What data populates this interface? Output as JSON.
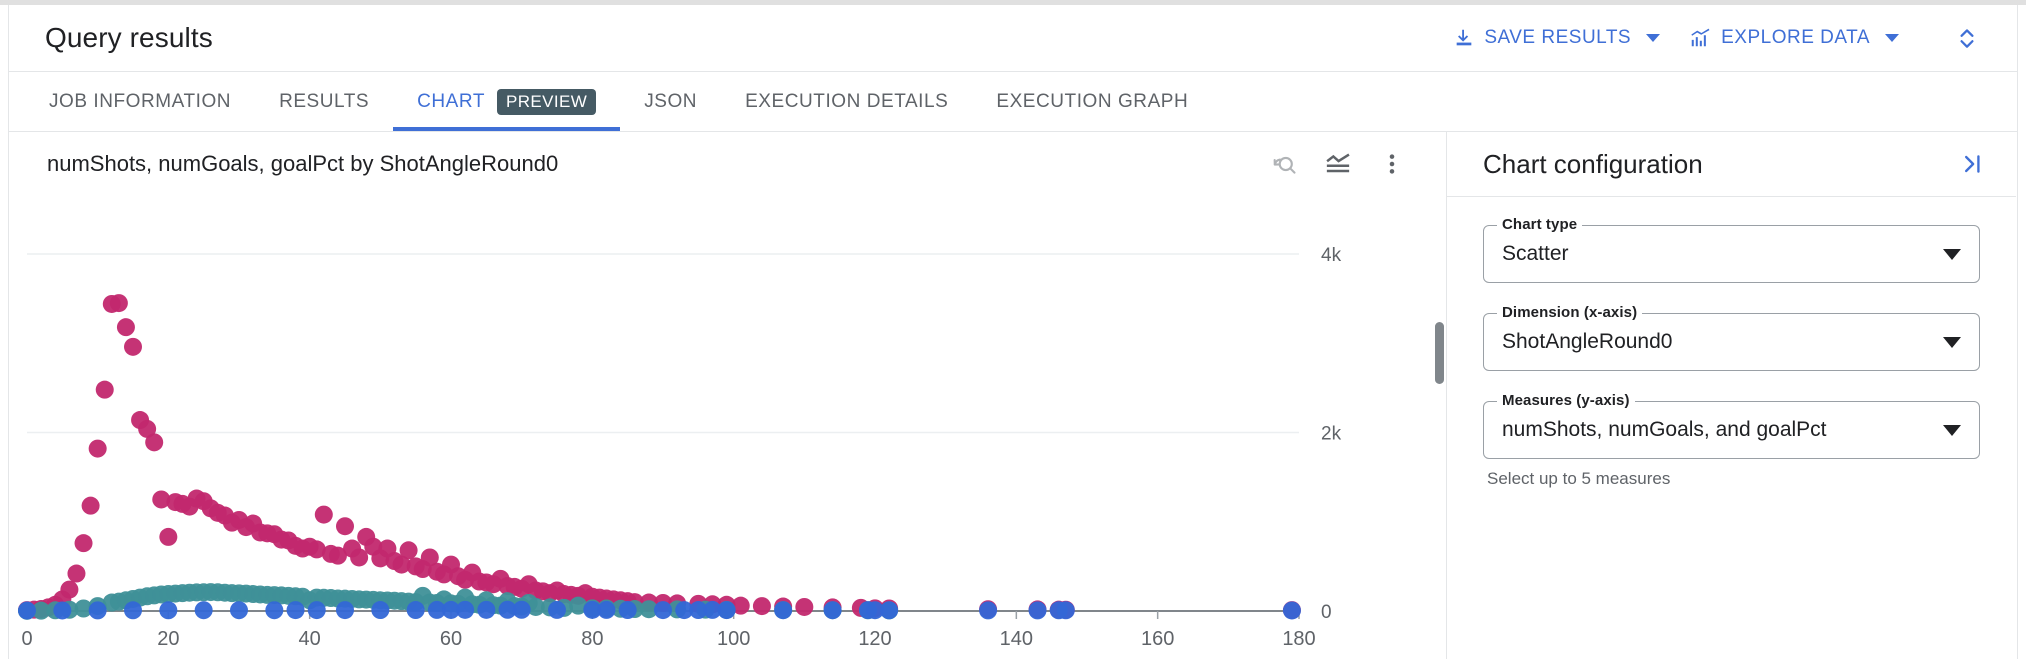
{
  "header": {
    "title": "Query results",
    "save_results_label": "SAVE RESULTS",
    "explore_data_label": "EXPLORE DATA",
    "save_icon": "download-icon",
    "explore_icon": "bar-chart-trend-icon",
    "expand_icon": "unfold-more-icon"
  },
  "tabs": [
    {
      "label": "JOB INFORMATION",
      "active": false
    },
    {
      "label": "RESULTS",
      "active": false
    },
    {
      "label": "CHART",
      "active": true,
      "chip": "PREVIEW"
    },
    {
      "label": "JSON",
      "active": false
    },
    {
      "label": "EXECUTION DETAILS",
      "active": false
    },
    {
      "label": "EXECUTION GRAPH",
      "active": false
    }
  ],
  "chart_panel": {
    "title": "numShots, numGoals, goalPct by ShotAngleRound0",
    "tools": [
      {
        "name": "reset-zoom-icon"
      },
      {
        "name": "chart-series-toggle-icon"
      },
      {
        "name": "more-options-icon"
      }
    ]
  },
  "config": {
    "title": "Chart configuration",
    "collapse_icon": "collapse-panel-right-icon",
    "fields": [
      {
        "label": "Chart type",
        "value": "Scatter"
      },
      {
        "label": "Dimension (x-axis)",
        "value": "ShotAngleRound0"
      },
      {
        "label": "Measures (y-axis)",
        "value": "numShots, numGoals, and goalPct",
        "hint": "Select up to 5 measures"
      }
    ]
  },
  "colors": {
    "accent_blue": "#3f6fd6",
    "series_numshots": "#c2286e",
    "series_numgoals": "#3f9098",
    "series_goalpct": "#3367d6",
    "preview_chip": "#455a64",
    "text_primary": "#202124",
    "text_secondary": "#5f6368"
  },
  "chart_data": {
    "type": "scatter",
    "title": "numShots, numGoals, goalPct by ShotAngleRound0",
    "xlabel": "ShotAngleRound0",
    "ylabel": "",
    "xlim": [
      0,
      180
    ],
    "ylim": [
      0,
      4000
    ],
    "xticks": [
      0,
      20,
      40,
      60,
      80,
      100,
      120,
      140,
      160,
      180
    ],
    "yticks": [
      0,
      2000,
      4000
    ],
    "ytick_labels": [
      "0",
      "2k",
      "4k"
    ],
    "grid": "horizontal",
    "legend_position": "none",
    "series": [
      {
        "name": "numShots",
        "color": "#c2286e",
        "points": [
          [
            0,
            10
          ],
          [
            1,
            15
          ],
          [
            2,
            22
          ],
          [
            3,
            40
          ],
          [
            4,
            70
          ],
          [
            5,
            130
          ],
          [
            6,
            240
          ],
          [
            7,
            420
          ],
          [
            8,
            760
          ],
          [
            9,
            1180
          ],
          [
            10,
            1820
          ],
          [
            11,
            2480
          ],
          [
            12,
            3440
          ],
          [
            13,
            3450
          ],
          [
            14,
            3180
          ],
          [
            15,
            2960
          ],
          [
            16,
            2140
          ],
          [
            17,
            2040
          ],
          [
            18,
            1890
          ],
          [
            19,
            1250
          ],
          [
            20,
            830
          ],
          [
            21,
            1220
          ],
          [
            22,
            1200
          ],
          [
            23,
            1170
          ],
          [
            24,
            1260
          ],
          [
            25,
            1230
          ],
          [
            26,
            1150
          ],
          [
            27,
            1100
          ],
          [
            28,
            1070
          ],
          [
            29,
            990
          ],
          [
            30,
            1020
          ],
          [
            31,
            940
          ],
          [
            32,
            980
          ],
          [
            33,
            880
          ],
          [
            34,
            870
          ],
          [
            35,
            860
          ],
          [
            36,
            800
          ],
          [
            37,
            790
          ],
          [
            38,
            730
          ],
          [
            39,
            700
          ],
          [
            40,
            720
          ],
          [
            41,
            690
          ],
          [
            42,
            1080
          ],
          [
            43,
            640
          ],
          [
            44,
            620
          ],
          [
            45,
            950
          ],
          [
            46,
            700
          ],
          [
            47,
            600
          ],
          [
            48,
            830
          ],
          [
            49,
            720
          ],
          [
            50,
            590
          ],
          [
            51,
            700
          ],
          [
            52,
            560
          ],
          [
            53,
            520
          ],
          [
            54,
            680
          ],
          [
            55,
            500
          ],
          [
            56,
            470
          ],
          [
            57,
            600
          ],
          [
            58,
            440
          ],
          [
            59,
            410
          ],
          [
            60,
            520
          ],
          [
            61,
            390
          ],
          [
            62,
            350
          ],
          [
            63,
            430
          ],
          [
            64,
            330
          ],
          [
            65,
            320
          ],
          [
            66,
            300
          ],
          [
            67,
            360
          ],
          [
            68,
            280
          ],
          [
            69,
            270
          ],
          [
            70,
            250
          ],
          [
            71,
            300
          ],
          [
            72,
            230
          ],
          [
            73,
            220
          ],
          [
            74,
            200
          ],
          [
            75,
            230
          ],
          [
            76,
            190
          ],
          [
            77,
            180
          ],
          [
            78,
            170
          ],
          [
            79,
            200
          ],
          [
            80,
            160
          ],
          [
            81,
            150
          ],
          [
            82,
            140
          ],
          [
            83,
            130
          ],
          [
            84,
            120
          ],
          [
            85,
            110
          ],
          [
            86,
            100
          ],
          [
            88,
            95
          ],
          [
            90,
            90
          ],
          [
            92,
            85
          ],
          [
            95,
            80
          ],
          [
            97,
            75
          ],
          [
            99,
            70
          ],
          [
            101,
            60
          ],
          [
            104,
            55
          ],
          [
            107,
            50
          ],
          [
            110,
            45
          ],
          [
            114,
            40
          ],
          [
            118,
            35
          ],
          [
            120,
            30
          ],
          [
            122,
            28
          ],
          [
            136,
            20
          ],
          [
            143,
            18
          ],
          [
            146,
            15
          ],
          [
            147,
            14
          ],
          [
            179,
            10
          ]
        ]
      },
      {
        "name": "numGoals",
        "color": "#3f9098",
        "points": [
          [
            0,
            2
          ],
          [
            2,
            4
          ],
          [
            4,
            8
          ],
          [
            6,
            14
          ],
          [
            8,
            28
          ],
          [
            10,
            55
          ],
          [
            12,
            95
          ],
          [
            13,
            105
          ],
          [
            14,
            120
          ],
          [
            15,
            135
          ],
          [
            16,
            150
          ],
          [
            17,
            165
          ],
          [
            18,
            175
          ],
          [
            19,
            185
          ],
          [
            20,
            190
          ],
          [
            21,
            195
          ],
          [
            22,
            200
          ],
          [
            23,
            205
          ],
          [
            24,
            208
          ],
          [
            25,
            210
          ],
          [
            26,
            212
          ],
          [
            27,
            210
          ],
          [
            28,
            205
          ],
          [
            29,
            200
          ],
          [
            30,
            198
          ],
          [
            31,
            195
          ],
          [
            32,
            190
          ],
          [
            33,
            185
          ],
          [
            34,
            180
          ],
          [
            35,
            178
          ],
          [
            36,
            175
          ],
          [
            37,
            170
          ],
          [
            38,
            165
          ],
          [
            39,
            160
          ],
          [
            40,
            120
          ],
          [
            41,
            150
          ],
          [
            42,
            148
          ],
          [
            43,
            145
          ],
          [
            44,
            140
          ],
          [
            45,
            138
          ],
          [
            46,
            135
          ],
          [
            47,
            130
          ],
          [
            48,
            128
          ],
          [
            49,
            125
          ],
          [
            50,
            120
          ],
          [
            51,
            118
          ],
          [
            52,
            115
          ],
          [
            53,
            110
          ],
          [
            54,
            105
          ],
          [
            55,
            100
          ],
          [
            56,
            170
          ],
          [
            57,
            95
          ],
          [
            58,
            90
          ],
          [
            59,
            130
          ],
          [
            60,
            85
          ],
          [
            61,
            80
          ],
          [
            62,
            150
          ],
          [
            63,
            75
          ],
          [
            64,
            70
          ],
          [
            65,
            120
          ],
          [
            66,
            65
          ],
          [
            67,
            60
          ],
          [
            68,
            110
          ],
          [
            69,
            55
          ],
          [
            70,
            50
          ],
          [
            71,
            90
          ],
          [
            72,
            45
          ],
          [
            74,
            40
          ],
          [
            76,
            35
          ],
          [
            78,
            60
          ],
          [
            80,
            30
          ],
          [
            82,
            28
          ],
          [
            84,
            25
          ],
          [
            86,
            22
          ],
          [
            88,
            20
          ],
          [
            92,
            18
          ],
          [
            96,
            15
          ],
          [
            99,
            12
          ],
          [
            107,
            10
          ],
          [
            114,
            9
          ],
          [
            119,
            8
          ],
          [
            122,
            7
          ]
        ]
      },
      {
        "name": "goalPct",
        "color": "#3367d6",
        "points": [
          [
            0,
            5
          ],
          [
            5,
            6
          ],
          [
            10,
            7
          ],
          [
            15,
            8
          ],
          [
            20,
            8
          ],
          [
            25,
            9
          ],
          [
            30,
            9
          ],
          [
            35,
            9
          ],
          [
            38,
            10
          ],
          [
            41,
            10
          ],
          [
            45,
            10
          ],
          [
            50,
            11
          ],
          [
            55,
            11
          ],
          [
            58,
            12
          ],
          [
            60,
            12
          ],
          [
            62,
            13
          ],
          [
            65,
            13
          ],
          [
            68,
            14
          ],
          [
            70,
            14
          ],
          [
            75,
            12
          ],
          [
            80,
            13
          ],
          [
            82,
            12
          ],
          [
            85,
            11
          ],
          [
            90,
            10
          ],
          [
            93,
            10
          ],
          [
            95,
            11
          ],
          [
            97,
            12
          ],
          [
            99,
            10
          ],
          [
            107,
            9
          ],
          [
            114,
            9
          ],
          [
            119,
            10
          ],
          [
            120,
            9
          ],
          [
            122,
            8
          ],
          [
            136,
            7
          ],
          [
            143,
            7
          ],
          [
            146,
            8
          ],
          [
            147,
            8
          ],
          [
            179,
            6
          ]
        ]
      }
    ]
  }
}
